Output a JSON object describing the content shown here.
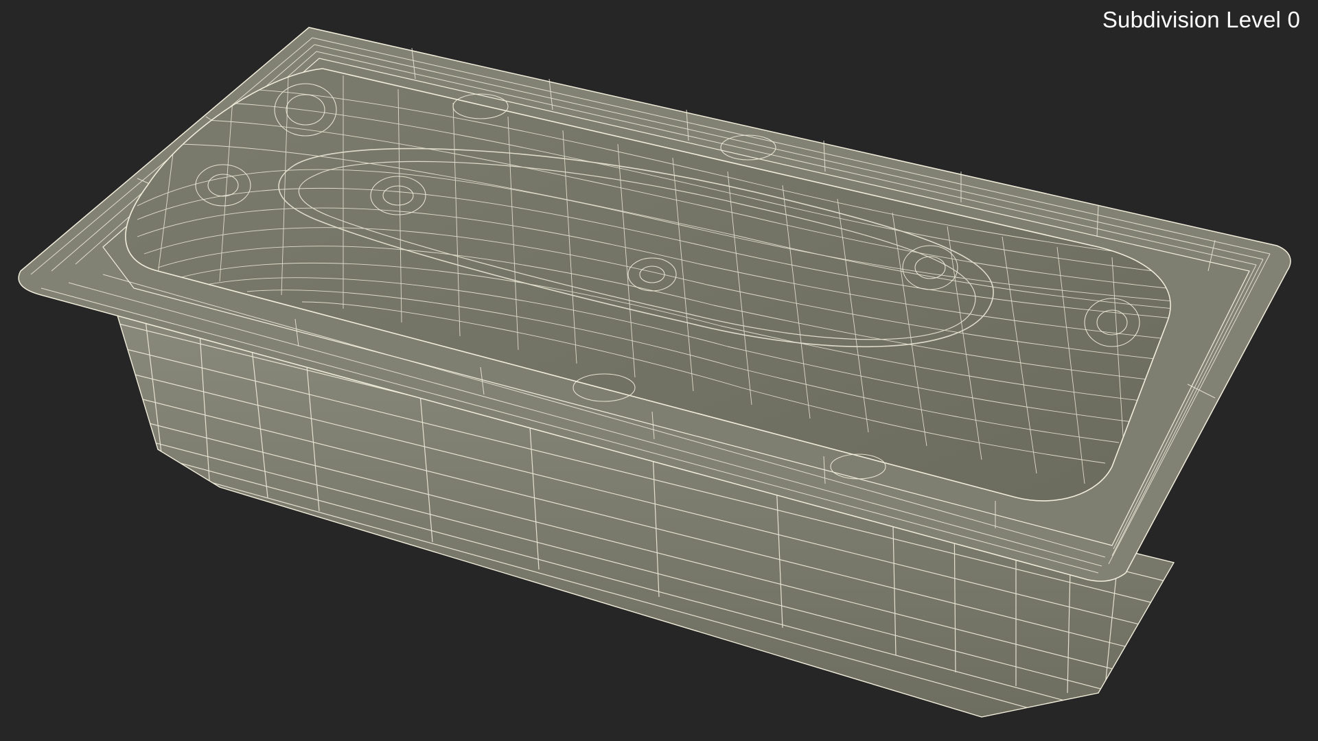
{
  "viewport": {
    "label": "Subdivision Level 0"
  },
  "colors": {
    "background": "#262626",
    "surface": "#7a7a6c",
    "wireframe": "#f2eedc"
  },
  "model": {
    "object": "bathtub",
    "display": "wireframe-on-shaded"
  }
}
